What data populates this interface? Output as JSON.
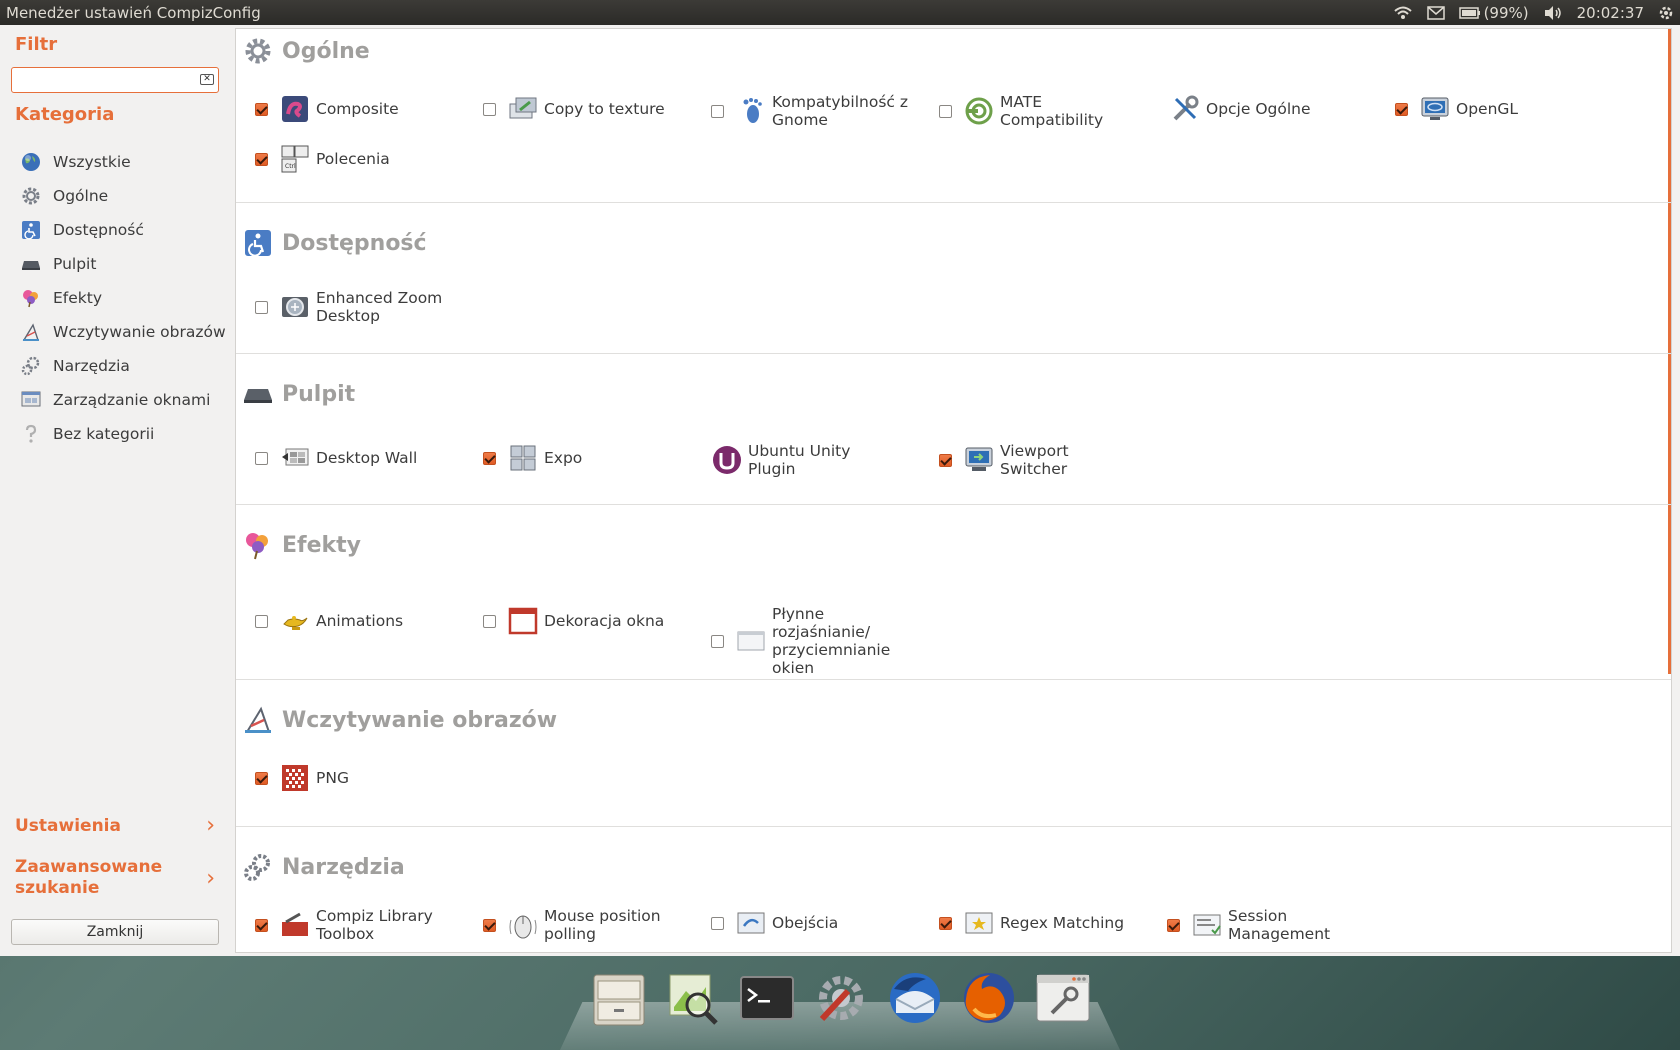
{
  "topbar": {
    "title": "Menedżer ustawień CompizConfig",
    "battery": "(99%)",
    "time": "20:02:37"
  },
  "sidebar": {
    "filter_heading": "Filtr",
    "filter_value": "",
    "category_heading": "Kategoria",
    "categories": [
      {
        "label": "Wszystkie",
        "icon": "globe-icon"
      },
      {
        "label": "Ogólne",
        "icon": "gear-icon"
      },
      {
        "label": "Dostępność",
        "icon": "accessibility-icon"
      },
      {
        "label": "Pulpit",
        "icon": "desktop-icon"
      },
      {
        "label": "Efekty",
        "icon": "effects-icon"
      },
      {
        "label": "Wczytywanie obrazów",
        "icon": "image-loading-icon"
      },
      {
        "label": "Narzędzia",
        "icon": "tools-icon"
      },
      {
        "label": "Zarządzanie oknami",
        "icon": "window-management-icon"
      },
      {
        "label": "Bez kategorii",
        "icon": "uncategorized-icon"
      }
    ],
    "settings_label": "Ustawienia",
    "advanced_search_label_1": "Zaawansowane",
    "advanced_search_label_2": "szukanie",
    "close_label": "Zamknij"
  },
  "sections": [
    {
      "title": "Ogólne",
      "plugins": [
        {
          "label": "Composite",
          "checked": true
        },
        {
          "label": "Copy to texture",
          "checked": false
        },
        {
          "label": "Kompatybilność z Gnome",
          "checked": false
        },
        {
          "label": "MATE Compatibility",
          "checked": false
        },
        {
          "label": "Opcje Ogólne",
          "checked": null
        },
        {
          "label": "OpenGL",
          "checked": true
        },
        {
          "label": "Polecenia",
          "checked": true
        }
      ]
    },
    {
      "title": "Dostępność",
      "plugins": [
        {
          "label": "Enhanced Zoom Desktop",
          "checked": false
        }
      ]
    },
    {
      "title": "Pulpit",
      "plugins": [
        {
          "label": "Desktop Wall",
          "checked": false
        },
        {
          "label": "Expo",
          "checked": true
        },
        {
          "label": "Ubuntu Unity Plugin",
          "checked": null
        },
        {
          "label": "Viewport Switcher",
          "checked": true
        }
      ]
    },
    {
      "title": "Efekty",
      "plugins": [
        {
          "label": "Animations",
          "checked": false
        },
        {
          "label": "Dekoracja okna",
          "checked": false
        },
        {
          "label": "Płynne rozjaśnianie/ przyciemnianie okien",
          "checked": false
        }
      ]
    },
    {
      "title": "Wczytywanie obrazów",
      "plugins": [
        {
          "label": "PNG",
          "checked": true
        }
      ]
    },
    {
      "title": "Narzędzia",
      "plugins": [
        {
          "label": "Compiz Library Toolbox",
          "checked": true
        },
        {
          "label": "Mouse position polling",
          "checked": true
        },
        {
          "label": "Obejścia",
          "checked": false
        },
        {
          "label": "Regex Matching",
          "checked": true
        },
        {
          "label": "Session Management",
          "checked": true
        }
      ]
    }
  ],
  "dock": [
    "file-cabinet-icon",
    "image-viewer-icon",
    "terminal-icon",
    "settings-tool-icon",
    "thunderbird-icon",
    "firefox-icon",
    "window-tool-icon"
  ],
  "colors": {
    "accent": "#e66f3a",
    "heading_gray": "#a09f9d"
  }
}
